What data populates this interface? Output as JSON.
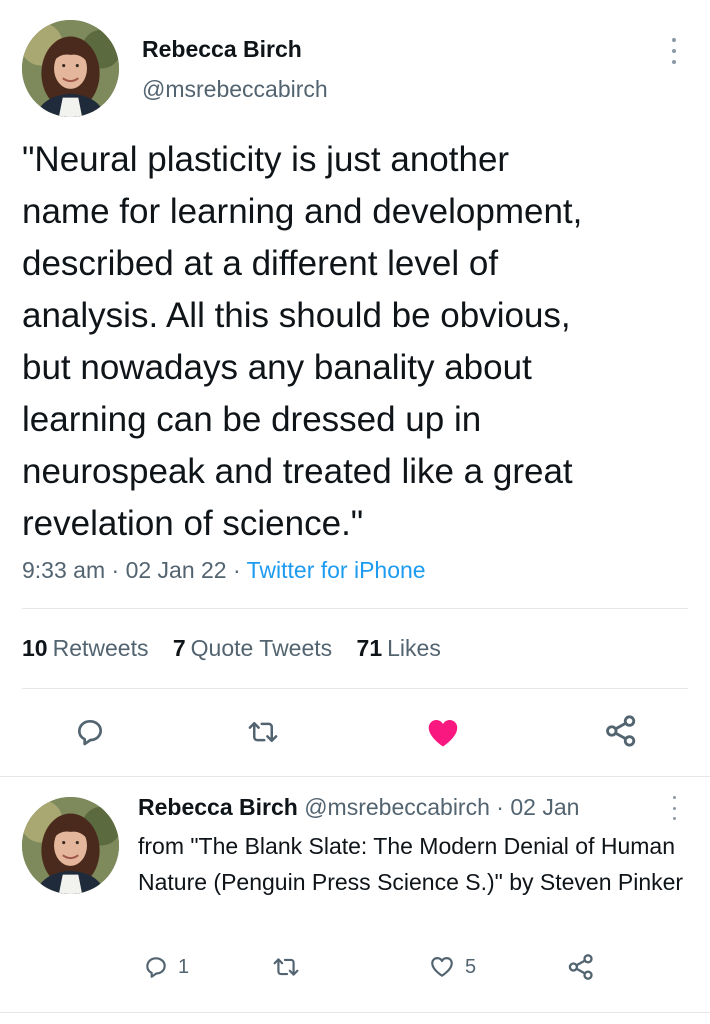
{
  "main_tweet": {
    "author_name": "Rebecca Birch",
    "author_handle": "@msrebeccabirch",
    "text": "\"Neural plasticity is just another\nname for learning and development,\ndescribed at a different level of\nanalysis. All this should be obvious,\nbut nowadays any banality about\nlearning can be dressed up in\nneurospeak and treated like a great\nrevelation of science.\"",
    "time": "9:33 am",
    "separator": " · ",
    "date": "02 Jan 22",
    "source": "Twitter for iPhone",
    "stats": {
      "retweets_count": "10",
      "retweets_label": "Retweets",
      "quote_count": "7",
      "quote_label": "Quote Tweets",
      "likes_count": "71",
      "likes_label": "Likes"
    },
    "actions": [
      "reply-icon",
      "retweet-icon",
      "heart-filled-icon",
      "share-icon"
    ],
    "liked": true
  },
  "reply_tweet": {
    "author_name": "Rebecca Birch",
    "author_handle": "@msrebeccabirch",
    "separator": " · ",
    "date": "02 Jan",
    "text": "from \"The Blank Slate: The Modern Denial of Human Nature (Penguin Press Science S.)\" by Steven Pinker",
    "reply_count": "1",
    "like_count": "5",
    "actions": [
      "reply-icon",
      "retweet-icon",
      "heart-outline-icon",
      "share-icon"
    ]
  },
  "colors": {
    "text": "#0f1419",
    "muted": "#536471",
    "link": "#1d9bf0",
    "like": "#f91880",
    "divider": "#e4e7ea"
  }
}
